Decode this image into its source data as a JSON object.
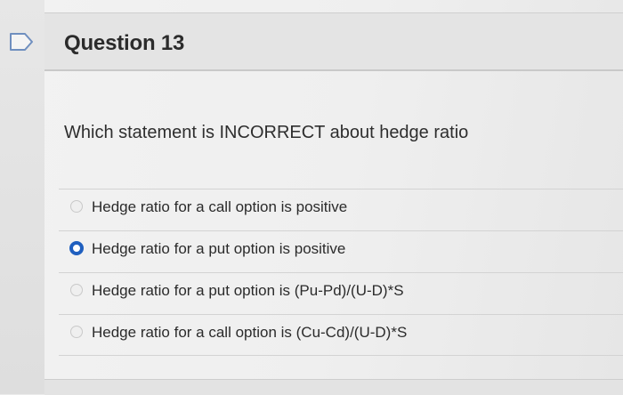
{
  "question": {
    "title": "Question 13",
    "prompt": "Which statement is INCORRECT about hedge ratio",
    "answers": [
      {
        "label": "Hedge ratio for a call option is positive",
        "selected": false
      },
      {
        "label": "Hedge ratio for a put option is positive",
        "selected": true
      },
      {
        "label": "Hedge ratio for a put option is (Pu-Pd)/(U-D)*S",
        "selected": false
      },
      {
        "label": "Hedge ratio for a call option is (Cu-Cd)/(U-D)*S",
        "selected": false
      }
    ]
  },
  "icons": {
    "flag": "flag-icon"
  },
  "colors": {
    "selected_radio": "#1f5fbf",
    "flag_outline": "#6f8fbf"
  }
}
